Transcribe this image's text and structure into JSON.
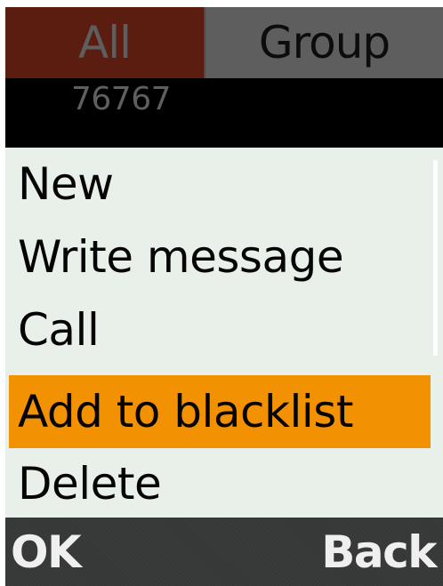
{
  "tabs": {
    "all_label": "All",
    "group_label": "Group"
  },
  "contact": {
    "number": "76767"
  },
  "menu": {
    "items": [
      {
        "label": "New"
      },
      {
        "label": "Write message"
      },
      {
        "label": "Call"
      },
      {
        "label": "Add to blacklist",
        "selected": true
      },
      {
        "label": "Delete"
      }
    ]
  },
  "softkeys": {
    "left_label": "OK",
    "right_label": "Back"
  },
  "colors": {
    "active_tab": "#5a1d0f",
    "inactive_tab": "#5e5e5e",
    "menu_background": "#e9efe9",
    "selection": "#f29203",
    "softkey_bar": "#363838"
  }
}
